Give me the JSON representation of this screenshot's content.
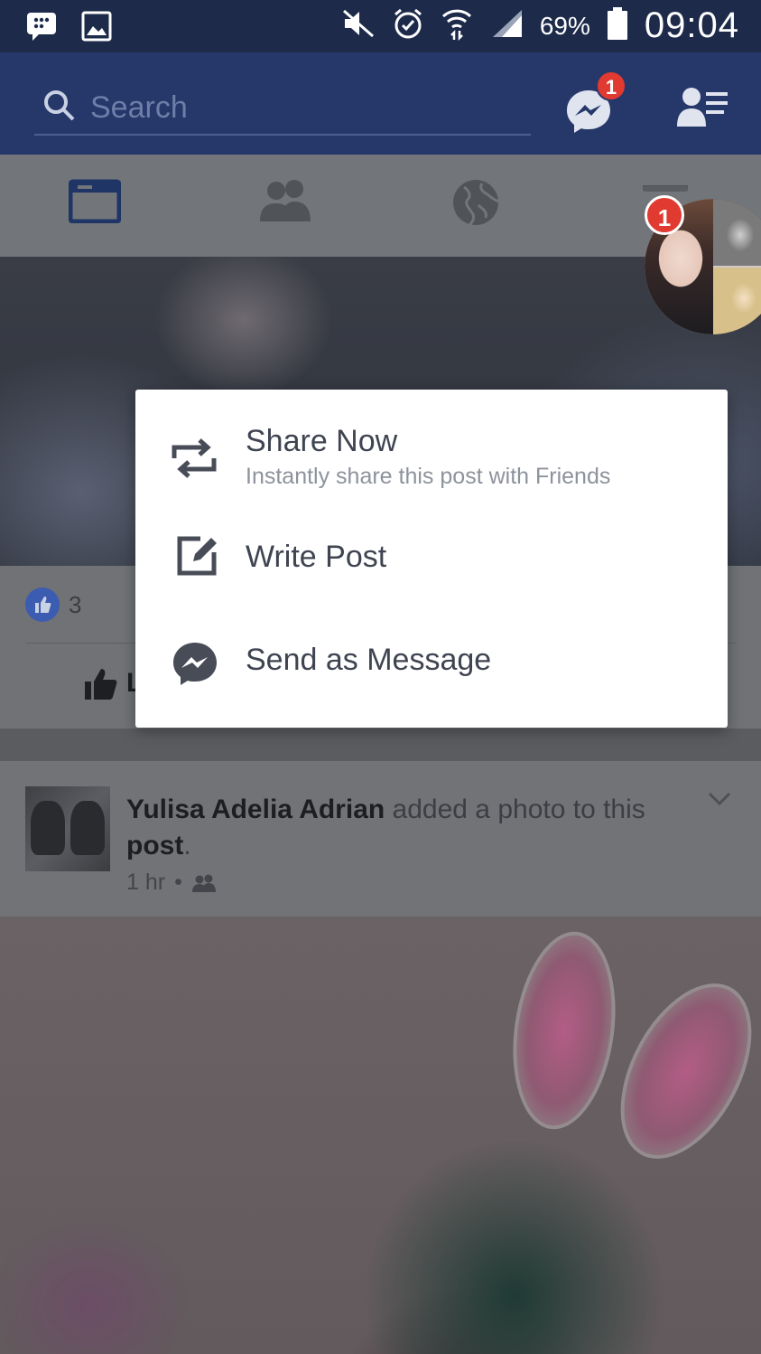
{
  "status_bar": {
    "battery_percent": "69%",
    "time": "09:04",
    "icons": [
      "bbm-icon",
      "gallery-icon",
      "mute-icon",
      "alarm-icon",
      "wifi-icon",
      "signal-icon",
      "battery-icon"
    ]
  },
  "header": {
    "search_placeholder": "Search",
    "messenger_badge": "1"
  },
  "tabs": [
    "news-feed-tab",
    "friend-requests-tab",
    "notifications-tab",
    "menu-tab"
  ],
  "chat_head": {
    "badge": "1"
  },
  "post1": {
    "like_count": "3",
    "like_label": "L"
  },
  "share_dialog": {
    "options": [
      {
        "title": "Share Now",
        "subtitle": "Instantly share this post with Friends",
        "icon": "share-repeat-icon"
      },
      {
        "title": "Write Post",
        "icon": "edit-icon"
      },
      {
        "title": "Send as Message",
        "icon": "messenger-icon"
      }
    ]
  },
  "post2": {
    "author": "Yulisa Adelia Adrian",
    "action": "added a photo to this",
    "object": "post",
    "punct": ".",
    "time": "1 hr",
    "dot": "•"
  },
  "colors": {
    "header_bg": "#26386a",
    "statusbar_bg": "#1d2a4a",
    "badge": "#e13a31",
    "accent": "#3b5cb0"
  }
}
